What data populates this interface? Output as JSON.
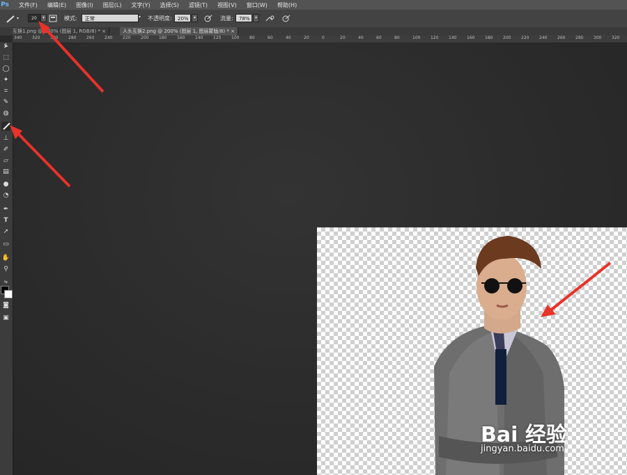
{
  "app": {
    "logo": "Ps"
  },
  "menu": [
    "文件(F)",
    "编辑(E)",
    "图像(I)",
    "图层(L)",
    "文字(Y)",
    "选择(S)",
    "滤镜(T)",
    "视图(V)",
    "窗口(W)",
    "帮助(H)"
  ],
  "options": {
    "brush_size": "20",
    "mode_label": "模式:",
    "mode_value": "正常",
    "opacity_label": "不透明度:",
    "opacity_value": "20%",
    "flow_label": "流量:",
    "flow_value": "78%"
  },
  "tabs": [
    {
      "label": "互换1.png @ 200% (图层 1, RGB/8) *",
      "close": "×"
    },
    {
      "label": "人头互换2.png @ 200% (图层 1, 图层蒙版/8) *",
      "close": "×"
    }
  ],
  "ruler_labels": [
    "340",
    "320",
    "300",
    "280",
    "260",
    "240",
    "220",
    "200",
    "180",
    "160",
    "140",
    "120",
    "100",
    "80",
    "60",
    "40",
    "20",
    "0",
    "20",
    "40",
    "60",
    "80",
    "100",
    "120",
    "140",
    "160",
    "180",
    "200",
    "220",
    "240",
    "260",
    "280",
    "300",
    "320"
  ],
  "watermark": {
    "brand": "Bai 经验",
    "url": "jingyan.baidu.com"
  },
  "colors": {
    "annotation_arrow": "#e8322a"
  }
}
